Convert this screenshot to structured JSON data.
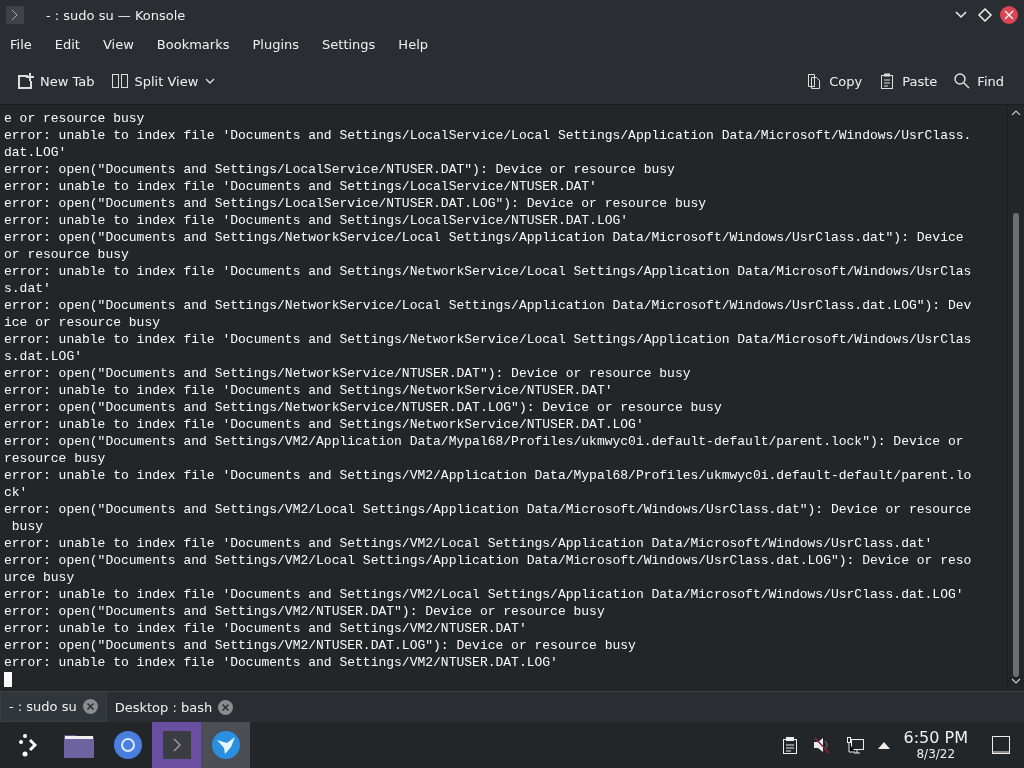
{
  "window": {
    "title": "- : sudo su — Konsole"
  },
  "menu": [
    "File",
    "Edit",
    "View",
    "Bookmarks",
    "Plugins",
    "Settings",
    "Help"
  ],
  "toolbar": {
    "left": [
      {
        "label": "New Tab",
        "kind": "newtab"
      },
      {
        "label": "Split View",
        "kind": "split"
      }
    ],
    "right": [
      {
        "label": "Copy",
        "kind": "copy"
      },
      {
        "label": "Paste",
        "kind": "paste"
      },
      {
        "label": "Find",
        "kind": "find"
      }
    ]
  },
  "terminal": {
    "lines": [
      "e or resource busy",
      "error: unable to index file 'Documents and Settings/LocalService/Local Settings/Application Data/Microsoft/Windows/UsrClass.",
      "dat.LOG'",
      "error: open(\"Documents and Settings/LocalService/NTUSER.DAT\"): Device or resource busy",
      "error: unable to index file 'Documents and Settings/LocalService/NTUSER.DAT'",
      "error: open(\"Documents and Settings/LocalService/NTUSER.DAT.LOG\"): Device or resource busy",
      "error: unable to index file 'Documents and Settings/LocalService/NTUSER.DAT.LOG'",
      "error: open(\"Documents and Settings/NetworkService/Local Settings/Application Data/Microsoft/Windows/UsrClass.dat\"): Device",
      "or resource busy",
      "error: unable to index file 'Documents and Settings/NetworkService/Local Settings/Application Data/Microsoft/Windows/UsrClas",
      "s.dat'",
      "error: open(\"Documents and Settings/NetworkService/Local Settings/Application Data/Microsoft/Windows/UsrClass.dat.LOG\"): Dev",
      "ice or resource busy",
      "error: unable to index file 'Documents and Settings/NetworkService/Local Settings/Application Data/Microsoft/Windows/UsrClas",
      "s.dat.LOG'",
      "error: open(\"Documents and Settings/NetworkService/NTUSER.DAT\"): Device or resource busy",
      "error: unable to index file 'Documents and Settings/NetworkService/NTUSER.DAT'",
      "error: open(\"Documents and Settings/NetworkService/NTUSER.DAT.LOG\"): Device or resource busy",
      "error: unable to index file 'Documents and Settings/NetworkService/NTUSER.DAT.LOG'",
      "error: open(\"Documents and Settings/VM2/Application Data/Mypal68/Profiles/ukmwyc0i.default-default/parent.lock\"): Device or",
      "resource busy",
      "error: unable to index file 'Documents and Settings/VM2/Application Data/Mypal68/Profiles/ukmwyc0i.default-default/parent.lo",
      "ck'",
      "error: open(\"Documents and Settings/VM2/Local Settings/Application Data/Microsoft/Windows/UsrClass.dat\"): Device or resource",
      " busy",
      "error: unable to index file 'Documents and Settings/VM2/Local Settings/Application Data/Microsoft/Windows/UsrClass.dat'",
      "error: open(\"Documents and Settings/VM2/Local Settings/Application Data/Microsoft/Windows/UsrClass.dat.LOG\"): Device or reso",
      "urce busy",
      "error: unable to index file 'Documents and Settings/VM2/Local Settings/Application Data/Microsoft/Windows/UsrClass.dat.LOG'",
      "error: open(\"Documents and Settings/VM2/NTUSER.DAT\"): Device or resource busy",
      "error: unable to index file 'Documents and Settings/VM2/NTUSER.DAT'",
      "error: open(\"Documents and Settings/VM2/NTUSER.DAT.LOG\"): Device or resource busy",
      "error: unable to index file 'Documents and Settings/VM2/NTUSER.DAT.LOG'"
    ]
  },
  "tabs": [
    {
      "label": "- : sudo su",
      "selected": true
    },
    {
      "label": "Desktop : bash",
      "selected": false
    }
  ],
  "taskbar": {
    "apps": [
      {
        "kind": "launcher",
        "selected": false
      },
      {
        "kind": "files",
        "selected": false
      },
      {
        "kind": "browser",
        "selected": false
      },
      {
        "kind": "terminal",
        "selected": true
      },
      {
        "kind": "bird",
        "selected": false
      }
    ],
    "time": "6:50 PM",
    "date": "8/3/22"
  }
}
